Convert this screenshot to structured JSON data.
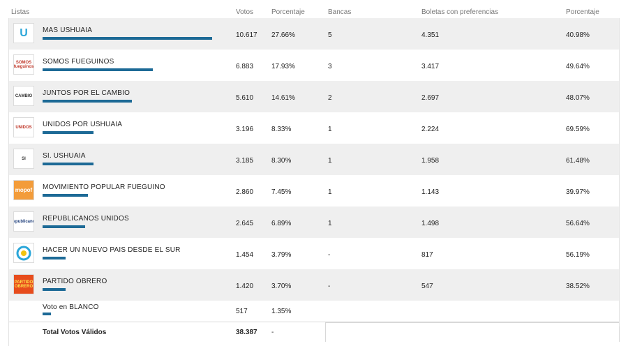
{
  "headers": {
    "listas": "Listas",
    "votos": "Votos",
    "porcentaje": "Porcentaje",
    "bancas": "Bancas",
    "boletas": "Boletas con preferencias",
    "porcentaje2": "Porcentaje"
  },
  "rows": [
    {
      "name": "MAS USHUAIA",
      "logo": "U",
      "logo_color": "#2aa6d9",
      "votes": "10.617",
      "pct": "27.66%",
      "bancas": "5",
      "boletas": "4.351",
      "pct2": "40.98%",
      "share": 0.2766
    },
    {
      "name": "SOMOS FUEGUINOS",
      "logo": "SOMOS fueguinos",
      "logo_color": "#c0392b",
      "votes": "6.883",
      "pct": "17.93%",
      "bancas": "3",
      "boletas": "3.417",
      "pct2": "49.64%",
      "share": 0.1793
    },
    {
      "name": "JUNTOS POR EL CAMBIO",
      "logo": "CAMBIO",
      "logo_color": "#333333",
      "votes": "5.610",
      "pct": "14.61%",
      "bancas": "2",
      "boletas": "2.697",
      "pct2": "48.07%",
      "share": 0.1461
    },
    {
      "name": "UNIDOS POR USHUAIA",
      "logo": "UNIDOS",
      "logo_color": "#c0392b",
      "votes": "3.196",
      "pct": "8.33%",
      "bancas": "1",
      "boletas": "2.224",
      "pct2": "69.59%",
      "share": 0.0833
    },
    {
      "name": "SI. USHUAIA",
      "logo": "SI",
      "logo_color": "#333333",
      "votes": "3.185",
      "pct": "8.30%",
      "bancas": "1",
      "boletas": "1.958",
      "pct2": "61.48%",
      "share": 0.083
    },
    {
      "name": "MOVIMIENTO POPULAR FUEGUINO",
      "logo": "mopof",
      "logo_color": "#f39c3a",
      "votes": "2.860",
      "pct": "7.45%",
      "bancas": "1",
      "boletas": "1.143",
      "pct2": "39.97%",
      "share": 0.0745
    },
    {
      "name": "REPUBLICANOS UNIDOS",
      "logo": "Republicanos",
      "logo_color": "#1d3d7a",
      "votes": "2.645",
      "pct": "6.89%",
      "bancas": "1",
      "boletas": "1.498",
      "pct2": "56.64%",
      "share": 0.0689
    },
    {
      "name": "HACER UN NUEVO PAIS DESDE EL SUR",
      "logo": "",
      "logo_color": "#2aa6d9",
      "votes": "1.454",
      "pct": "3.79%",
      "bancas": "-",
      "boletas": "817",
      "pct2": "56.19%",
      "share": 0.0379
    },
    {
      "name": "PARTIDO OBRERO",
      "logo": "PARTIDO OBRERO",
      "logo_color": "#e74c1c",
      "votes": "1.420",
      "pct": "3.70%",
      "bancas": "-",
      "boletas": "547",
      "pct2": "38.52%",
      "share": 0.037
    }
  ],
  "blank": {
    "name": "Voto en BLANCO",
    "votes": "517",
    "pct": "1.35%",
    "share": 0.0135
  },
  "total": {
    "label": "Total Votos Válidos",
    "votes": "38.387",
    "pct": "-"
  },
  "bar_color": "#1d6a96"
}
